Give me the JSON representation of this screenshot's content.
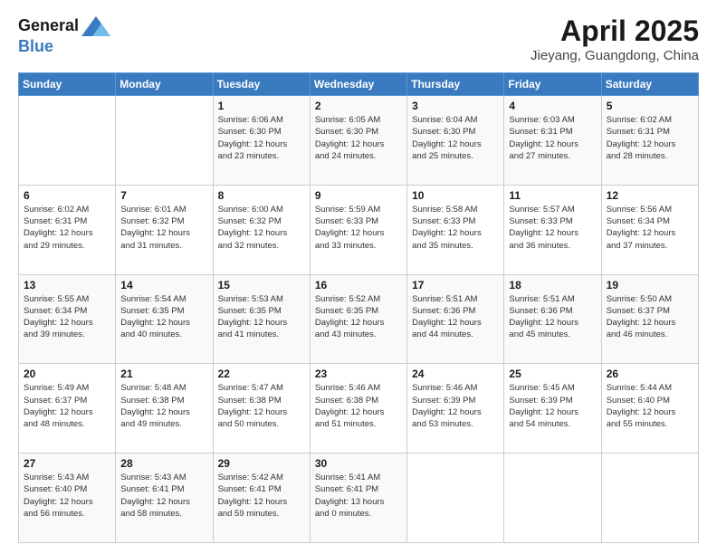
{
  "header": {
    "logo_line1": "General",
    "logo_line2": "Blue",
    "main_title": "April 2025",
    "subtitle": "Jieyang, Guangdong, China"
  },
  "days_of_week": [
    "Sunday",
    "Monday",
    "Tuesday",
    "Wednesday",
    "Thursday",
    "Friday",
    "Saturday"
  ],
  "weeks": [
    [
      {
        "day": "",
        "info": ""
      },
      {
        "day": "",
        "info": ""
      },
      {
        "day": "1",
        "info": "Sunrise: 6:06 AM\nSunset: 6:30 PM\nDaylight: 12 hours\nand 23 minutes."
      },
      {
        "day": "2",
        "info": "Sunrise: 6:05 AM\nSunset: 6:30 PM\nDaylight: 12 hours\nand 24 minutes."
      },
      {
        "day": "3",
        "info": "Sunrise: 6:04 AM\nSunset: 6:30 PM\nDaylight: 12 hours\nand 25 minutes."
      },
      {
        "day": "4",
        "info": "Sunrise: 6:03 AM\nSunset: 6:31 PM\nDaylight: 12 hours\nand 27 minutes."
      },
      {
        "day": "5",
        "info": "Sunrise: 6:02 AM\nSunset: 6:31 PM\nDaylight: 12 hours\nand 28 minutes."
      }
    ],
    [
      {
        "day": "6",
        "info": "Sunrise: 6:02 AM\nSunset: 6:31 PM\nDaylight: 12 hours\nand 29 minutes."
      },
      {
        "day": "7",
        "info": "Sunrise: 6:01 AM\nSunset: 6:32 PM\nDaylight: 12 hours\nand 31 minutes."
      },
      {
        "day": "8",
        "info": "Sunrise: 6:00 AM\nSunset: 6:32 PM\nDaylight: 12 hours\nand 32 minutes."
      },
      {
        "day": "9",
        "info": "Sunrise: 5:59 AM\nSunset: 6:33 PM\nDaylight: 12 hours\nand 33 minutes."
      },
      {
        "day": "10",
        "info": "Sunrise: 5:58 AM\nSunset: 6:33 PM\nDaylight: 12 hours\nand 35 minutes."
      },
      {
        "day": "11",
        "info": "Sunrise: 5:57 AM\nSunset: 6:33 PM\nDaylight: 12 hours\nand 36 minutes."
      },
      {
        "day": "12",
        "info": "Sunrise: 5:56 AM\nSunset: 6:34 PM\nDaylight: 12 hours\nand 37 minutes."
      }
    ],
    [
      {
        "day": "13",
        "info": "Sunrise: 5:55 AM\nSunset: 6:34 PM\nDaylight: 12 hours\nand 39 minutes."
      },
      {
        "day": "14",
        "info": "Sunrise: 5:54 AM\nSunset: 6:35 PM\nDaylight: 12 hours\nand 40 minutes."
      },
      {
        "day": "15",
        "info": "Sunrise: 5:53 AM\nSunset: 6:35 PM\nDaylight: 12 hours\nand 41 minutes."
      },
      {
        "day": "16",
        "info": "Sunrise: 5:52 AM\nSunset: 6:35 PM\nDaylight: 12 hours\nand 43 minutes."
      },
      {
        "day": "17",
        "info": "Sunrise: 5:51 AM\nSunset: 6:36 PM\nDaylight: 12 hours\nand 44 minutes."
      },
      {
        "day": "18",
        "info": "Sunrise: 5:51 AM\nSunset: 6:36 PM\nDaylight: 12 hours\nand 45 minutes."
      },
      {
        "day": "19",
        "info": "Sunrise: 5:50 AM\nSunset: 6:37 PM\nDaylight: 12 hours\nand 46 minutes."
      }
    ],
    [
      {
        "day": "20",
        "info": "Sunrise: 5:49 AM\nSunset: 6:37 PM\nDaylight: 12 hours\nand 48 minutes."
      },
      {
        "day": "21",
        "info": "Sunrise: 5:48 AM\nSunset: 6:38 PM\nDaylight: 12 hours\nand 49 minutes."
      },
      {
        "day": "22",
        "info": "Sunrise: 5:47 AM\nSunset: 6:38 PM\nDaylight: 12 hours\nand 50 minutes."
      },
      {
        "day": "23",
        "info": "Sunrise: 5:46 AM\nSunset: 6:38 PM\nDaylight: 12 hours\nand 51 minutes."
      },
      {
        "day": "24",
        "info": "Sunrise: 5:46 AM\nSunset: 6:39 PM\nDaylight: 12 hours\nand 53 minutes."
      },
      {
        "day": "25",
        "info": "Sunrise: 5:45 AM\nSunset: 6:39 PM\nDaylight: 12 hours\nand 54 minutes."
      },
      {
        "day": "26",
        "info": "Sunrise: 5:44 AM\nSunset: 6:40 PM\nDaylight: 12 hours\nand 55 minutes."
      }
    ],
    [
      {
        "day": "27",
        "info": "Sunrise: 5:43 AM\nSunset: 6:40 PM\nDaylight: 12 hours\nand 56 minutes."
      },
      {
        "day": "28",
        "info": "Sunrise: 5:43 AM\nSunset: 6:41 PM\nDaylight: 12 hours\nand 58 minutes."
      },
      {
        "day": "29",
        "info": "Sunrise: 5:42 AM\nSunset: 6:41 PM\nDaylight: 12 hours\nand 59 minutes."
      },
      {
        "day": "30",
        "info": "Sunrise: 5:41 AM\nSunset: 6:41 PM\nDaylight: 13 hours\nand 0 minutes."
      },
      {
        "day": "",
        "info": ""
      },
      {
        "day": "",
        "info": ""
      },
      {
        "day": "",
        "info": ""
      }
    ]
  ]
}
